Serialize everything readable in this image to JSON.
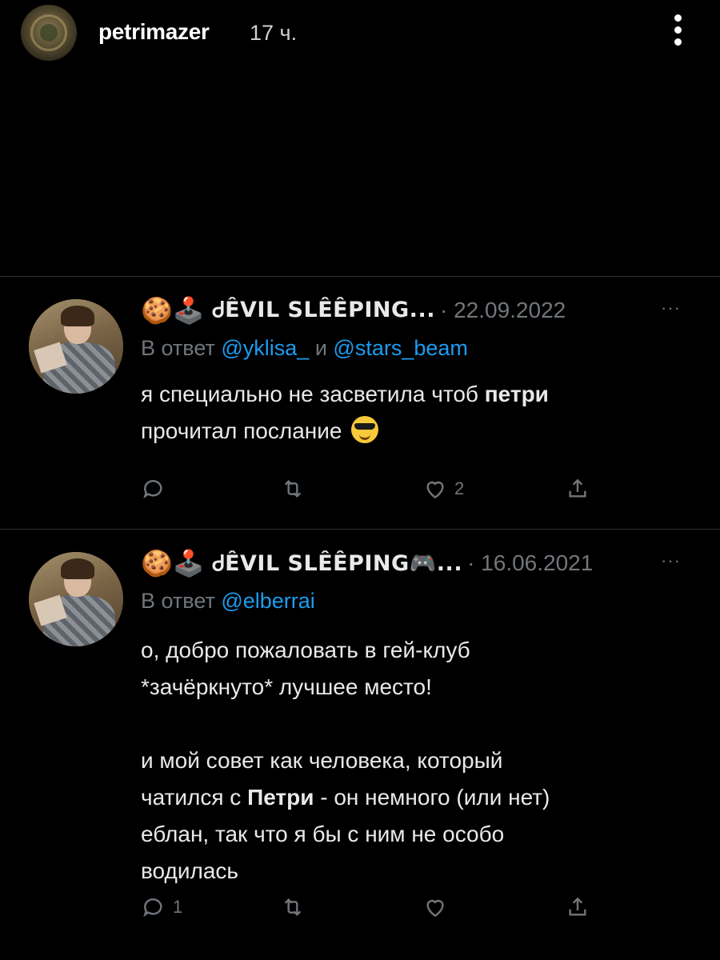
{
  "story": {
    "username": "petrimazer",
    "time_ago": "17 ч."
  },
  "tweets": [
    {
      "emojis": "🍪🕹️",
      "display_name": "ᏧÊVIL SLÊÊPING...",
      "date": "· 22.09.2022",
      "more": "···",
      "reply_prefix": "В ответ",
      "mentions": [
        "@yklisa_",
        "@stars_beam"
      ],
      "reply_join": "и",
      "text_lines": [
        "я специально не засветила чтоб",
        "петри",
        "прочитал послание"
      ],
      "actions": {
        "reply_count": "",
        "retweet_count": "",
        "like_count": "2"
      }
    },
    {
      "emojis": "🍪🕹️",
      "display_name": "ᏧÊVIL SLÊÊPING🎮...",
      "date": "· 16.06.2021",
      "more": "···",
      "reply_prefix": "В ответ",
      "mentions": [
        "@elberrai"
      ],
      "text_lines": [
        "о, добро пожаловать в гей-клуб",
        "*зачёркнуто* лучшее место!",
        "",
        "и мой совет как человека, который",
        "чатился с",
        "Петри",
        "- он немного (или нет)",
        "еблан, так что я бы с ним не особо",
        "водилась"
      ],
      "actions": {
        "reply_count": "1",
        "retweet_count": "",
        "like_count": ""
      }
    }
  ]
}
